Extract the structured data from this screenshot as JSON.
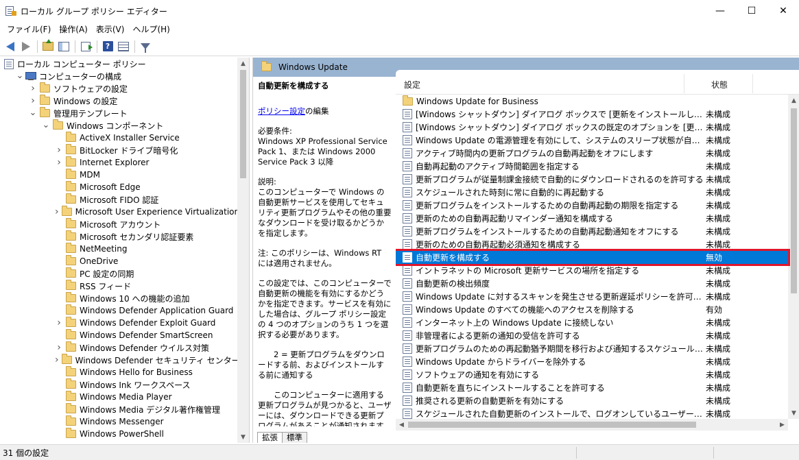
{
  "window": {
    "title": "ローカル グループ ポリシー エディター",
    "minimize": "—",
    "maximize": "☐",
    "close": "✕"
  },
  "menu": [
    "ファイル(F)",
    "操作(A)",
    "表示(V)",
    "ヘルプ(H)"
  ],
  "toolbar": {
    "help_glyph": "?"
  },
  "tree": [
    {
      "indent": 0,
      "twisty": "",
      "icon": "policy",
      "label": "ローカル コンピューター ポリシー"
    },
    {
      "indent": 1,
      "twisty": "v",
      "icon": "computer",
      "label": "コンピューターの構成"
    },
    {
      "indent": 2,
      "twisty": ">",
      "icon": "folder",
      "label": "ソフトウェアの設定"
    },
    {
      "indent": 2,
      "twisty": ">",
      "icon": "folder",
      "label": "Windows の設定"
    },
    {
      "indent": 2,
      "twisty": "v",
      "icon": "folder",
      "label": "管理用テンプレート"
    },
    {
      "indent": 3,
      "twisty": "v",
      "icon": "folder",
      "label": "Windows コンポーネント"
    },
    {
      "indent": 4,
      "twisty": "",
      "icon": "folder",
      "label": "ActiveX Installer Service"
    },
    {
      "indent": 4,
      "twisty": ">",
      "icon": "folder",
      "label": "BitLocker ドライブ暗号化"
    },
    {
      "indent": 4,
      "twisty": ">",
      "icon": "folder",
      "label": "Internet Explorer"
    },
    {
      "indent": 4,
      "twisty": "",
      "icon": "folder",
      "label": "MDM"
    },
    {
      "indent": 4,
      "twisty": "",
      "icon": "folder",
      "label": "Microsoft Edge"
    },
    {
      "indent": 4,
      "twisty": "",
      "icon": "folder",
      "label": "Microsoft FIDO 認証"
    },
    {
      "indent": 4,
      "twisty": ">",
      "icon": "folder",
      "label": "Microsoft User Experience Virtualization"
    },
    {
      "indent": 4,
      "twisty": "",
      "icon": "folder",
      "label": "Microsoft アカウント"
    },
    {
      "indent": 4,
      "twisty": "",
      "icon": "folder",
      "label": "Microsoft セカンダリ認証要素"
    },
    {
      "indent": 4,
      "twisty": "",
      "icon": "folder",
      "label": "NetMeeting"
    },
    {
      "indent": 4,
      "twisty": "",
      "icon": "folder",
      "label": "OneDrive"
    },
    {
      "indent": 4,
      "twisty": "",
      "icon": "folder",
      "label": "PC 設定の同期"
    },
    {
      "indent": 4,
      "twisty": "",
      "icon": "folder",
      "label": "RSS フィード"
    },
    {
      "indent": 4,
      "twisty": "",
      "icon": "folder",
      "label": "Windows 10 への機能の追加"
    },
    {
      "indent": 4,
      "twisty": "",
      "icon": "folder",
      "label": "Windows Defender Application Guard"
    },
    {
      "indent": 4,
      "twisty": ">",
      "icon": "folder",
      "label": "Windows Defender Exploit Guard"
    },
    {
      "indent": 4,
      "twisty": "",
      "icon": "folder",
      "label": "Windows Defender SmartScreen"
    },
    {
      "indent": 4,
      "twisty": ">",
      "icon": "folder",
      "label": "Windows Defender ウイルス対策"
    },
    {
      "indent": 4,
      "twisty": ">",
      "icon": "folder",
      "label": "Windows Defender セキュリティ センター"
    },
    {
      "indent": 4,
      "twisty": "",
      "icon": "folder",
      "label": "Windows Hello for Business"
    },
    {
      "indent": 4,
      "twisty": "",
      "icon": "folder",
      "label": "Windows Ink ワークスペース"
    },
    {
      "indent": 4,
      "twisty": "",
      "icon": "folder",
      "label": "Windows Media Player"
    },
    {
      "indent": 4,
      "twisty": "",
      "icon": "folder",
      "label": "Windows Media デジタル著作権管理"
    },
    {
      "indent": 4,
      "twisty": "",
      "icon": "folder",
      "label": "Windows Messenger"
    },
    {
      "indent": 4,
      "twisty": "",
      "icon": "folder",
      "label": "Windows PowerShell"
    }
  ],
  "header": {
    "title": "Windows Update"
  },
  "description": {
    "title": "自動更新を構成する",
    "edit_link": "ポリシー設定",
    "edit_suffix": "の編集",
    "requirements_label": "必要条件:",
    "requirements": "Windows XP Professional Service Pack 1、または Windows 2000 Service Pack 3 以降",
    "explanation_label": "説明:",
    "explanation": "このコンピューターで Windows の自動更新サービスを使用してセキュリティ更新プログラムやその他の重要なダウンロードを受け取るかどうかを指定します。",
    "note": "注: このポリシーは、Windows RT には適用されません。",
    "para1": "この設定では、このコンピューターで自動更新の機能を有効にするかどうかを指定できます。サービスを有効にした場合は、グループ ポリシー設定の 4 つのオプションのうち 1 つを選択する必要があります。",
    "para2": "　　2 = 更新プログラムをダウンロードする前、およびインストールする前に通知する",
    "para3": "　　このコンピューターに適用する更新プログラムが見つかると、ユーザーには、ダウンロードできる更新プログラムがあることが通知されます。Windows Update にアクセスすると、使用可能なすべての更"
  },
  "list": {
    "col_setting": "設定",
    "col_state": "状態",
    "rows": [
      {
        "icon": "folder",
        "name": "Windows Update for Business",
        "state": ""
      },
      {
        "icon": "policy",
        "name": "[Windows シャットダウン] ダイアログ ボックスで [更新をインストールしてシャットダウ...",
        "state": "未構成"
      },
      {
        "icon": "policy",
        "name": "[Windows シャットダウン] ダイアログ ボックスの既定のオプションを [更新をインスト...",
        "state": "未構成"
      },
      {
        "icon": "policy",
        "name": "Windows Update の電源管理を有効にして、システムのスリープ状態が自動的に...",
        "state": "未構成"
      },
      {
        "icon": "policy",
        "name": "アクティブ時間内の更新プログラムの自動再起動をオフにします",
        "state": "未構成"
      },
      {
        "icon": "policy",
        "name": "自動再起動のアクティブ時間範囲を指定する",
        "state": "未構成"
      },
      {
        "icon": "policy",
        "name": "更新プログラムが従量制課金接続で自動的にダウンロードされるのを許可する",
        "state": "未構成"
      },
      {
        "icon": "policy",
        "name": "スケジュールされた時刻に常に自動的に再起動する",
        "state": "未構成"
      },
      {
        "icon": "policy",
        "name": "更新プログラムをインストールするための自動再起動の期限を指定する",
        "state": "未構成"
      },
      {
        "icon": "policy",
        "name": "更新のための自動再起動リマインダー通知を構成する",
        "state": "未構成"
      },
      {
        "icon": "policy",
        "name": "更新プログラムをインストールするための自動再起動通知をオフにする",
        "state": "未構成"
      },
      {
        "icon": "policy",
        "name": "更新のための自動再起動必須通知を構成する",
        "state": "未構成"
      },
      {
        "icon": "policy",
        "name": "自動更新を構成する",
        "state": "無効",
        "selected": true
      },
      {
        "icon": "policy",
        "name": "イントラネットの Microsoft 更新サービスの場所を指定する",
        "state": "未構成"
      },
      {
        "icon": "policy",
        "name": "自動更新の検出頻度",
        "state": "未構成"
      },
      {
        "icon": "policy",
        "name": "Windows Update に対するスキャンを発生させる更新遅延ポリシーを許可しない",
        "state": "未構成"
      },
      {
        "icon": "policy",
        "name": "Windows Update のすべての機能へのアクセスを削除する",
        "state": "有効"
      },
      {
        "icon": "policy",
        "name": "インターネット上の Windows Update に接続しない",
        "state": "未構成"
      },
      {
        "icon": "policy",
        "name": "非管理者による更新の通知の受信を許可する",
        "state": "未構成"
      },
      {
        "icon": "policy",
        "name": "更新プログラムのための再起動猶予期間を移行および通知するスケジュールを指...",
        "state": "未構成"
      },
      {
        "icon": "policy",
        "name": "Windows Update からドライバーを除外する",
        "state": "未構成"
      },
      {
        "icon": "policy",
        "name": "ソフトウェアの通知を有効にする",
        "state": "未構成"
      },
      {
        "icon": "policy",
        "name": "自動更新を直ちにインストールすることを許可する",
        "state": "未構成"
      },
      {
        "icon": "policy",
        "name": "推奨される更新の自動更新を有効にする",
        "state": "未構成"
      },
      {
        "icon": "policy",
        "name": "スケジュールされた自動更新のインストールで、ログオンしているユーザーがいる場合に...",
        "state": "未構成"
      }
    ]
  },
  "tabs": [
    "拡張",
    "標準"
  ],
  "status": {
    "text": "31 個の設定"
  },
  "colors": {
    "header_band": "#99b4d1",
    "selection": "#0078d7",
    "highlight_border": "#e0162b"
  }
}
